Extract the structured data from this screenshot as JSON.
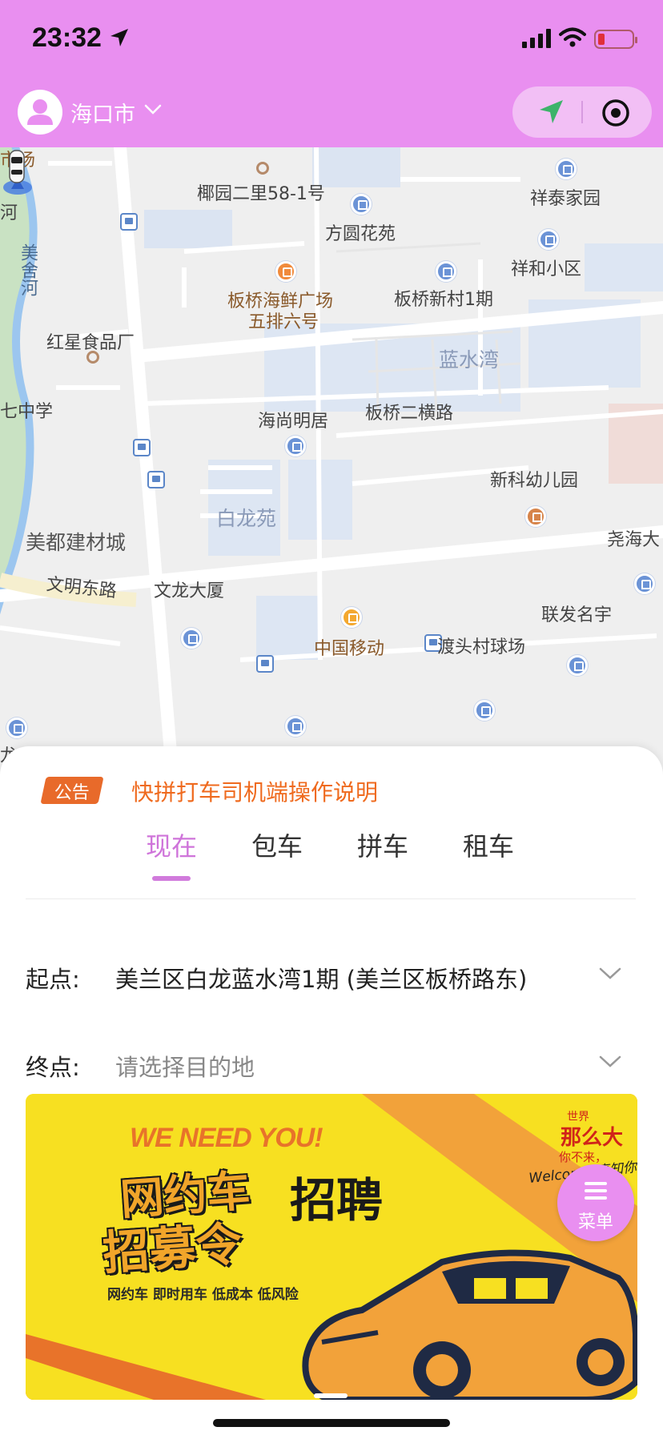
{
  "status": {
    "time": "23:32"
  },
  "header": {
    "city": "海口市"
  },
  "map": {
    "labels": {
      "market": "市场",
      "he": "河",
      "yeyuan": "椰园二里58-1号",
      "xiangtai": "祥泰家园",
      "fangyuan": "方圆花苑",
      "xianghe": "祥和小区",
      "meishe": "美舍河",
      "seafood1": "板桥海鲜广场",
      "seafood2": "五排六号",
      "banqiao_new": "板桥新村1期",
      "hongxing": "红星食品厂",
      "lanshuiwan": "蓝水湾",
      "qizhong": "七中学",
      "haishang": "海尚明居",
      "banqiao_road": "板桥二横路",
      "xinke": "新科幼儿园",
      "bailong": "白龙苑",
      "meidu": "美都建材城",
      "yaohai": "尧海大",
      "china_mobile": "中国移动",
      "wenming": "文明东路",
      "wenlong": "文龙大厦",
      "lianfa": "联发名宇",
      "dutou": "渡头村球场",
      "long": "龙"
    }
  },
  "notice": {
    "badge": "公告",
    "text": "快拼打车司机端操作说明"
  },
  "tabs": [
    "现在",
    "包车",
    "拼车",
    "租车"
  ],
  "active_tab": "现在",
  "form": {
    "start_label": "起点:",
    "start_value": "美兰区白龙蓝水湾1期 (美兰区板桥路东)",
    "end_label": "终点:",
    "end_placeholder": "请选择目的地"
  },
  "banner": {
    "headline": "WE NEED YOU!",
    "title_line1": "网约车",
    "title_line2": "招募令",
    "recruit": "招聘",
    "subtitle": "网约车  即时用车  低成本  低风险",
    "world": "世界",
    "big": "那么大",
    "small": "你不来，",
    "welcome": "Welcome 真知你"
  },
  "menu": {
    "label": "菜单"
  },
  "colors": {
    "accent": "#e98ff0",
    "notice": "#ef6a1e",
    "active_tab": "#cf74da"
  }
}
